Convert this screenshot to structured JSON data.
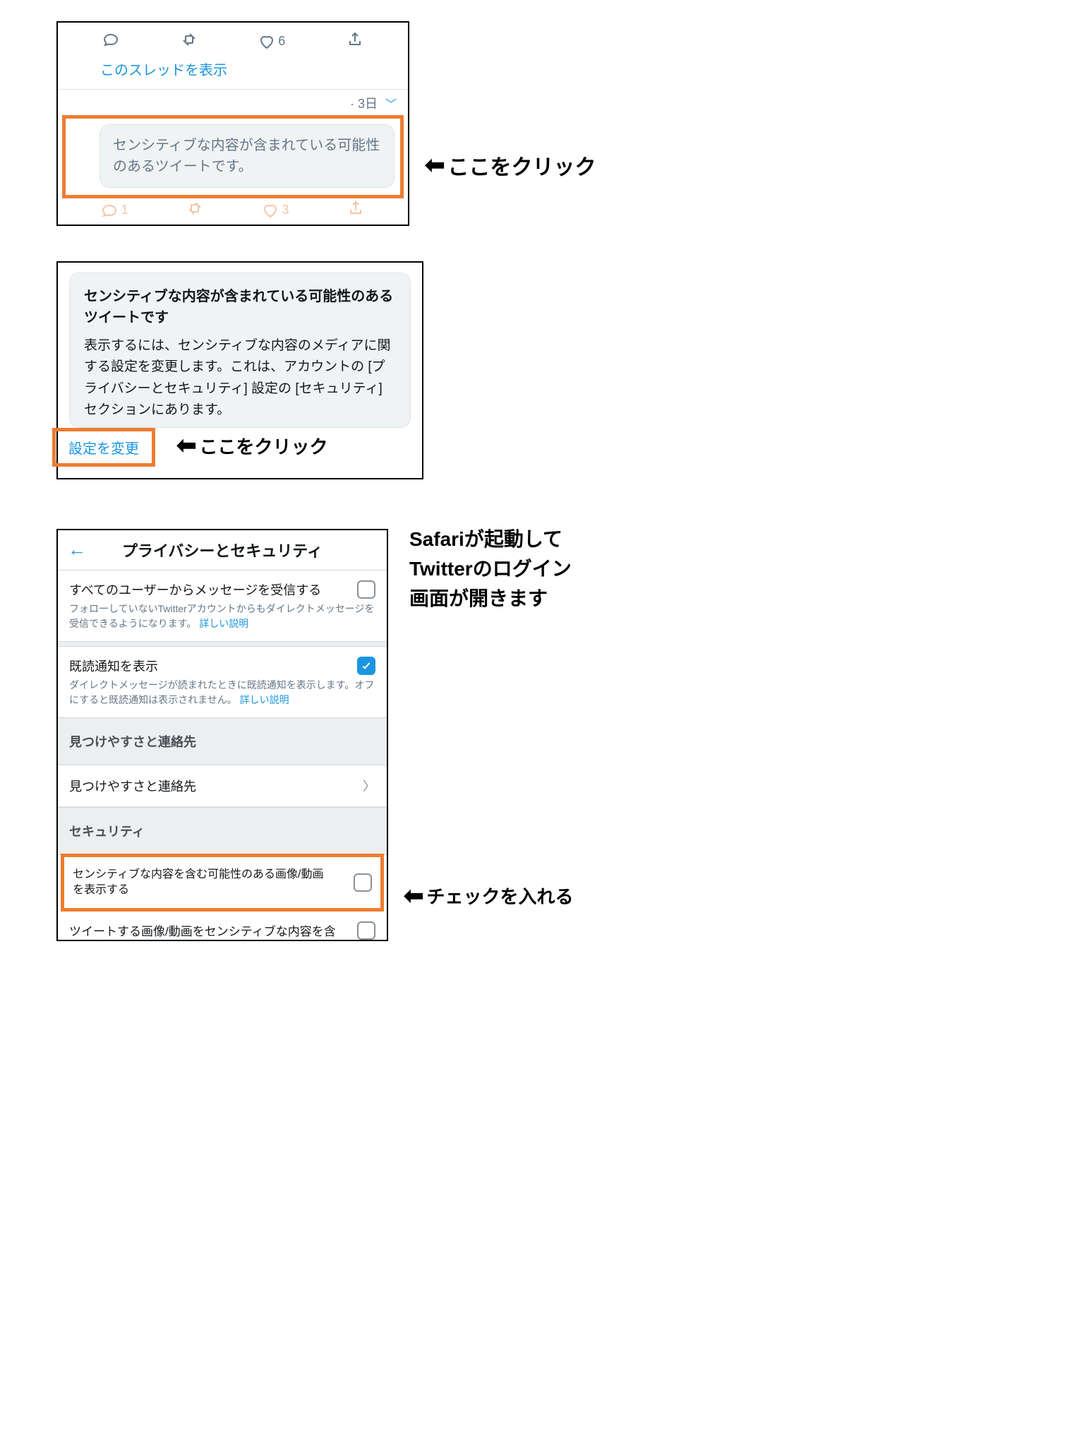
{
  "panel1": {
    "like_count": "6",
    "thread_link": "このスレッドを表示",
    "timestamp": "· 3日",
    "sensitive_text": "センシティブな内容が含まれている可能性のあるツイートです。",
    "faded_reply": "1",
    "faded_like": "3",
    "annotation": "ここをクリック"
  },
  "panel2": {
    "title": "センシティブな内容が含まれている可能性のあるツイートです",
    "body": "表示するには、センシティブな内容のメディアに関する設定を変更します。これは、アカウントの [プライバシーとセキュリティ] 設定の [セキュリティ] セクションにあります。",
    "change_link": "設定を変更",
    "annotation": "ここをクリック"
  },
  "panel3": {
    "header": "プライバシーとセキュリティ",
    "dm_receive_label": "すべてのユーザーからメッセージを受信する",
    "dm_receive_desc": "フォローしていないTwitterアカウントからもダイレクトメッセージを受信できるようになります。",
    "learn_more": "詳しい説明",
    "read_receipt_label": "既読通知を表示",
    "read_receipt_desc": "ダイレクトメッセージが読まれたときに既読通知を表示します。オフにすると既読通知は表示されません。",
    "discover_header": "見つけやすさと連絡先",
    "discover_row": "見つけやすさと連絡先",
    "security_header": "セキュリティ",
    "sensitive_media_label": "センシティブな内容を含む可能性のある画像/動画を表示する",
    "mark_media_label": "ツイートする画像/動画をセンシティブな内容を含",
    "side_annotation": "Safariが起動して\nTwitterのログイン\n画面が開きます",
    "check_annotation": "チェックを入れる"
  }
}
